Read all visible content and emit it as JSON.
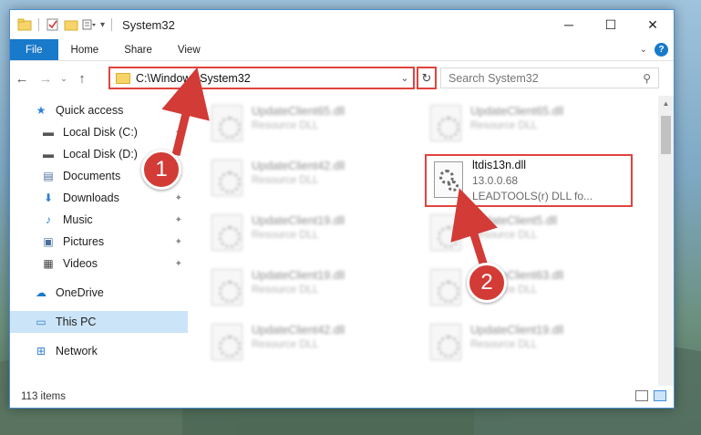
{
  "window": {
    "title": "System32",
    "controls": {
      "minimize": "─",
      "maximize": "☐",
      "close": "✕"
    }
  },
  "ribbon": {
    "tabs": [
      "File",
      "Home",
      "Share",
      "View"
    ],
    "help": "?",
    "collapse": "⌄"
  },
  "navigation": {
    "back": "←",
    "forward": "→",
    "recent": "⌄",
    "up": "↑",
    "address": "C:\\Windows\\System32",
    "address_dropdown": "⌄",
    "refresh": "↻",
    "search_placeholder": "Search System32",
    "search_icon": "⚲"
  },
  "sidebar": {
    "items": [
      {
        "label": "Quick access",
        "icon": "star-icon",
        "glyph": "★",
        "pinned": false
      },
      {
        "label": "Local Disk (C:)",
        "icon": "drive-icon",
        "glyph": "▬",
        "pinned": true
      },
      {
        "label": "Local Disk (D:)",
        "icon": "drive-icon",
        "glyph": "▬",
        "pinned": true
      },
      {
        "label": "Documents",
        "icon": "documents-icon",
        "glyph": "▤",
        "pinned": true
      },
      {
        "label": "Downloads",
        "icon": "downloads-icon",
        "glyph": "⬇",
        "pinned": true
      },
      {
        "label": "Music",
        "icon": "music-icon",
        "glyph": "♪",
        "pinned": true
      },
      {
        "label": "Pictures",
        "icon": "pictures-icon",
        "glyph": "▣",
        "pinned": true
      },
      {
        "label": "Videos",
        "icon": "videos-icon",
        "glyph": "▦",
        "pinned": true
      },
      {
        "label": "OneDrive",
        "icon": "cloud-icon",
        "glyph": "☁",
        "pinned": false
      },
      {
        "label": "This PC",
        "icon": "computer-icon",
        "glyph": "▭",
        "pinned": false,
        "selected": true
      },
      {
        "label": "Network",
        "icon": "network-icon",
        "glyph": "⊞",
        "pinned": false
      }
    ],
    "pin_glyph": "📌"
  },
  "files": [
    {
      "name": "UpdateClient65.dll",
      "desc": "Resource DLL"
    },
    {
      "name": "UpdateClient65.dll",
      "desc": "Resource DLL"
    },
    {
      "name": "UpdateClient42.dll",
      "desc": "Resource DLL"
    },
    {
      "name": "UpdateClient19.dll",
      "desc": "Resource DLL"
    },
    {
      "name": "UpdateClient5.dll",
      "desc": "Resource DLL"
    },
    {
      "name": "UpdateClient19.dll",
      "desc": "Resource DLL"
    },
    {
      "name": "UpdateClient63.dll",
      "desc": "Resource DLL"
    },
    {
      "name": "UpdateClient42.dll",
      "desc": "Resource DLL"
    },
    {
      "name": "UpdateClient19.dll",
      "desc": "Resource DLL"
    }
  ],
  "highlighted_file": {
    "name": "ltdis13n.dll",
    "version": "13.0.0.68",
    "description": "LEADTOOLS(r) DLL fo..."
  },
  "status": {
    "item_count": "113 items"
  },
  "callouts": {
    "first": "1",
    "second": "2"
  },
  "colors": {
    "accent": "#1979ca",
    "highlight_border": "#e0443e",
    "callout": "#d23b36",
    "selection": "#cce4f7"
  }
}
